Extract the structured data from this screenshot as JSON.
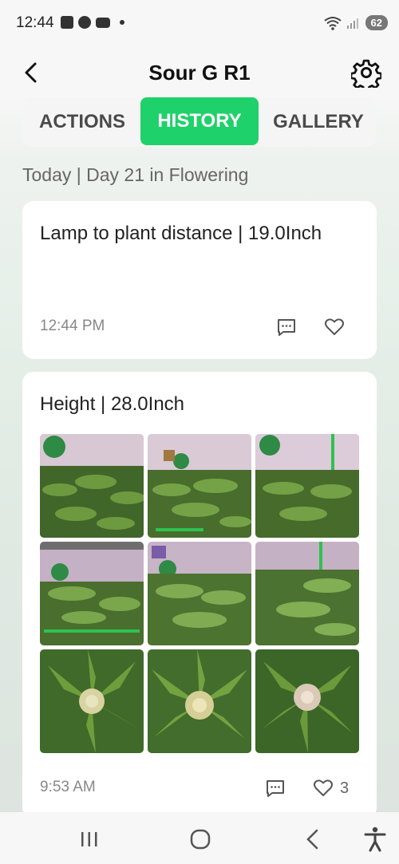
{
  "status_bar": {
    "time": "12:44",
    "battery": "62"
  },
  "header": {
    "title": "Sour G R1"
  },
  "tabs": [
    {
      "label": "ACTIONS",
      "active": false
    },
    {
      "label": "HISTORY",
      "active": true
    },
    {
      "label": "GALLERY",
      "active": false
    }
  ],
  "day_line": "Today | Day 21 in Flowering",
  "entries": [
    {
      "text": "Lamp to plant distance | 19.0Inch",
      "time": "12:44 PM",
      "likes": ""
    },
    {
      "text": "Height | 28.0Inch",
      "time": "9:53 AM",
      "likes": "3"
    }
  ],
  "photos": [
    "grow-tent-canopy-1",
    "grow-tent-canopy-2",
    "grow-tent-canopy-3",
    "grow-tent-canopy-4",
    "grow-tent-canopy-5",
    "grow-tent-canopy-6",
    "bud-closeup-1",
    "bud-closeup-2",
    "bud-closeup-3"
  ],
  "colors": {
    "accent": "#1fd16a",
    "tent": "#c9a9c7",
    "leaf": "#4f7d2e",
    "bud": "#d8d3a0"
  },
  "icons": [
    "back-chevron-icon",
    "gear-icon",
    "comment-icon",
    "heart-icon",
    "recent-apps-icon",
    "home-icon",
    "nav-back-icon",
    "accessibility-icon"
  ]
}
